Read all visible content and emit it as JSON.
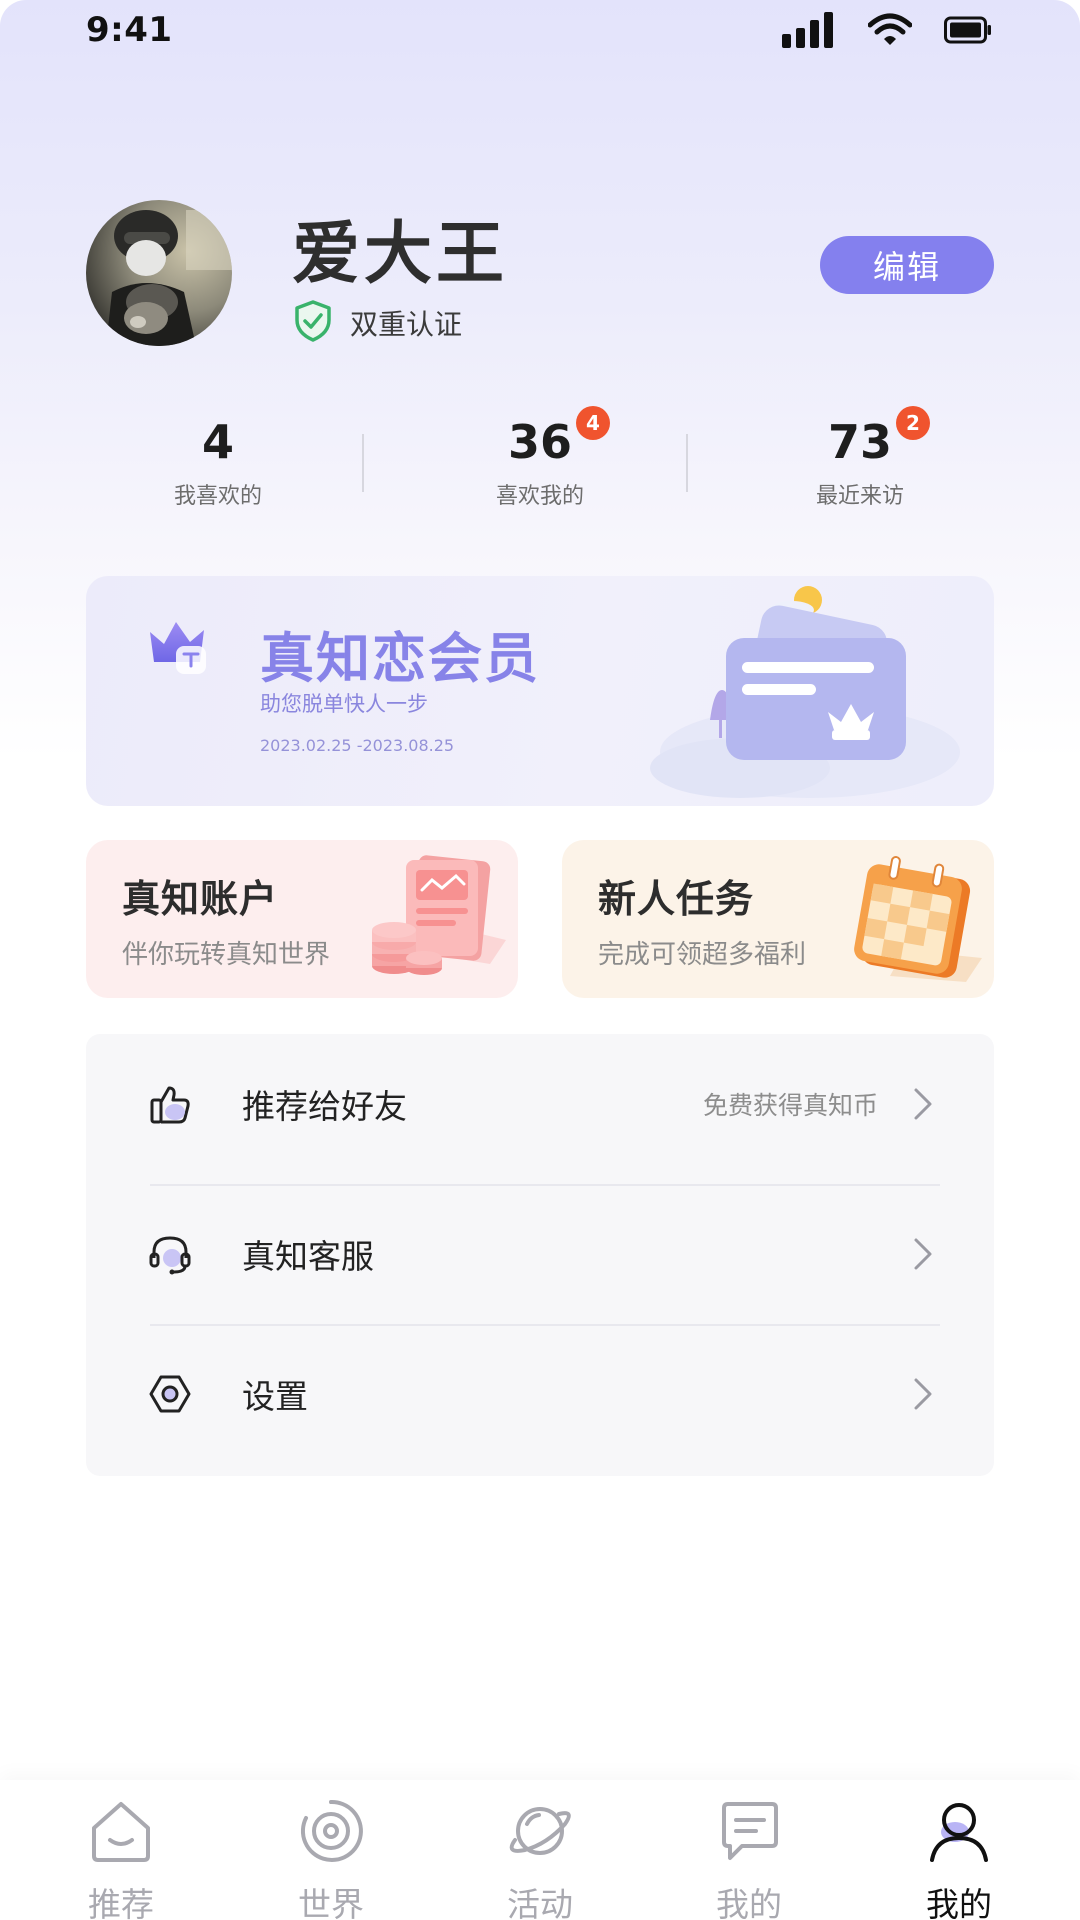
{
  "status_bar": {
    "time": "9:41",
    "icons": [
      "signal-icon",
      "wifi-icon",
      "battery-icon"
    ]
  },
  "profile": {
    "name": "爱大王",
    "verification": "双重认证",
    "edit_label": "编辑",
    "avatar_icon": "user-photo"
  },
  "stats": [
    {
      "value": "4",
      "label": "我喜欢的",
      "badge": null
    },
    {
      "value": "36",
      "label": "喜欢我的",
      "badge": "4"
    },
    {
      "value": "73",
      "label": "最近来访",
      "badge": "2"
    }
  ],
  "vip": {
    "title": "真知恋会员",
    "subtitle": "助您脱单快人一步",
    "dates": "2023.02.25 -2023.08.25",
    "icon": "crown-icon"
  },
  "cards": [
    {
      "title": "真知账户",
      "subtitle": "伴你玩转真知世界",
      "icon": "account-icon"
    },
    {
      "title": "新人任务",
      "subtitle": "完成可领超多福利",
      "icon": "calendar-icon"
    }
  ],
  "menu": [
    {
      "label": "推荐给好友",
      "extra": "免费获得真知币",
      "icon": "thumbs-up-icon"
    },
    {
      "label": "真知客服",
      "extra": "",
      "icon": "headset-icon"
    },
    {
      "label": "设置",
      "extra": "",
      "icon": "settings-icon"
    }
  ],
  "tabs": [
    {
      "label": "推荐",
      "icon": "home-icon",
      "active": false
    },
    {
      "label": "世界",
      "icon": "world-icon",
      "active": false
    },
    {
      "label": "活动",
      "icon": "planet-icon",
      "active": false
    },
    {
      "label": "我的",
      "icon": "message-icon",
      "active": false
    },
    {
      "label": "我的",
      "icon": "profile-icon",
      "active": true
    }
  ],
  "colors": {
    "accent": "#8480ee",
    "badge": "#f0542e",
    "verify_green": "#39b36b",
    "account_card_bg": "#fdeeee",
    "task_card_bg": "#fcf3e8"
  }
}
